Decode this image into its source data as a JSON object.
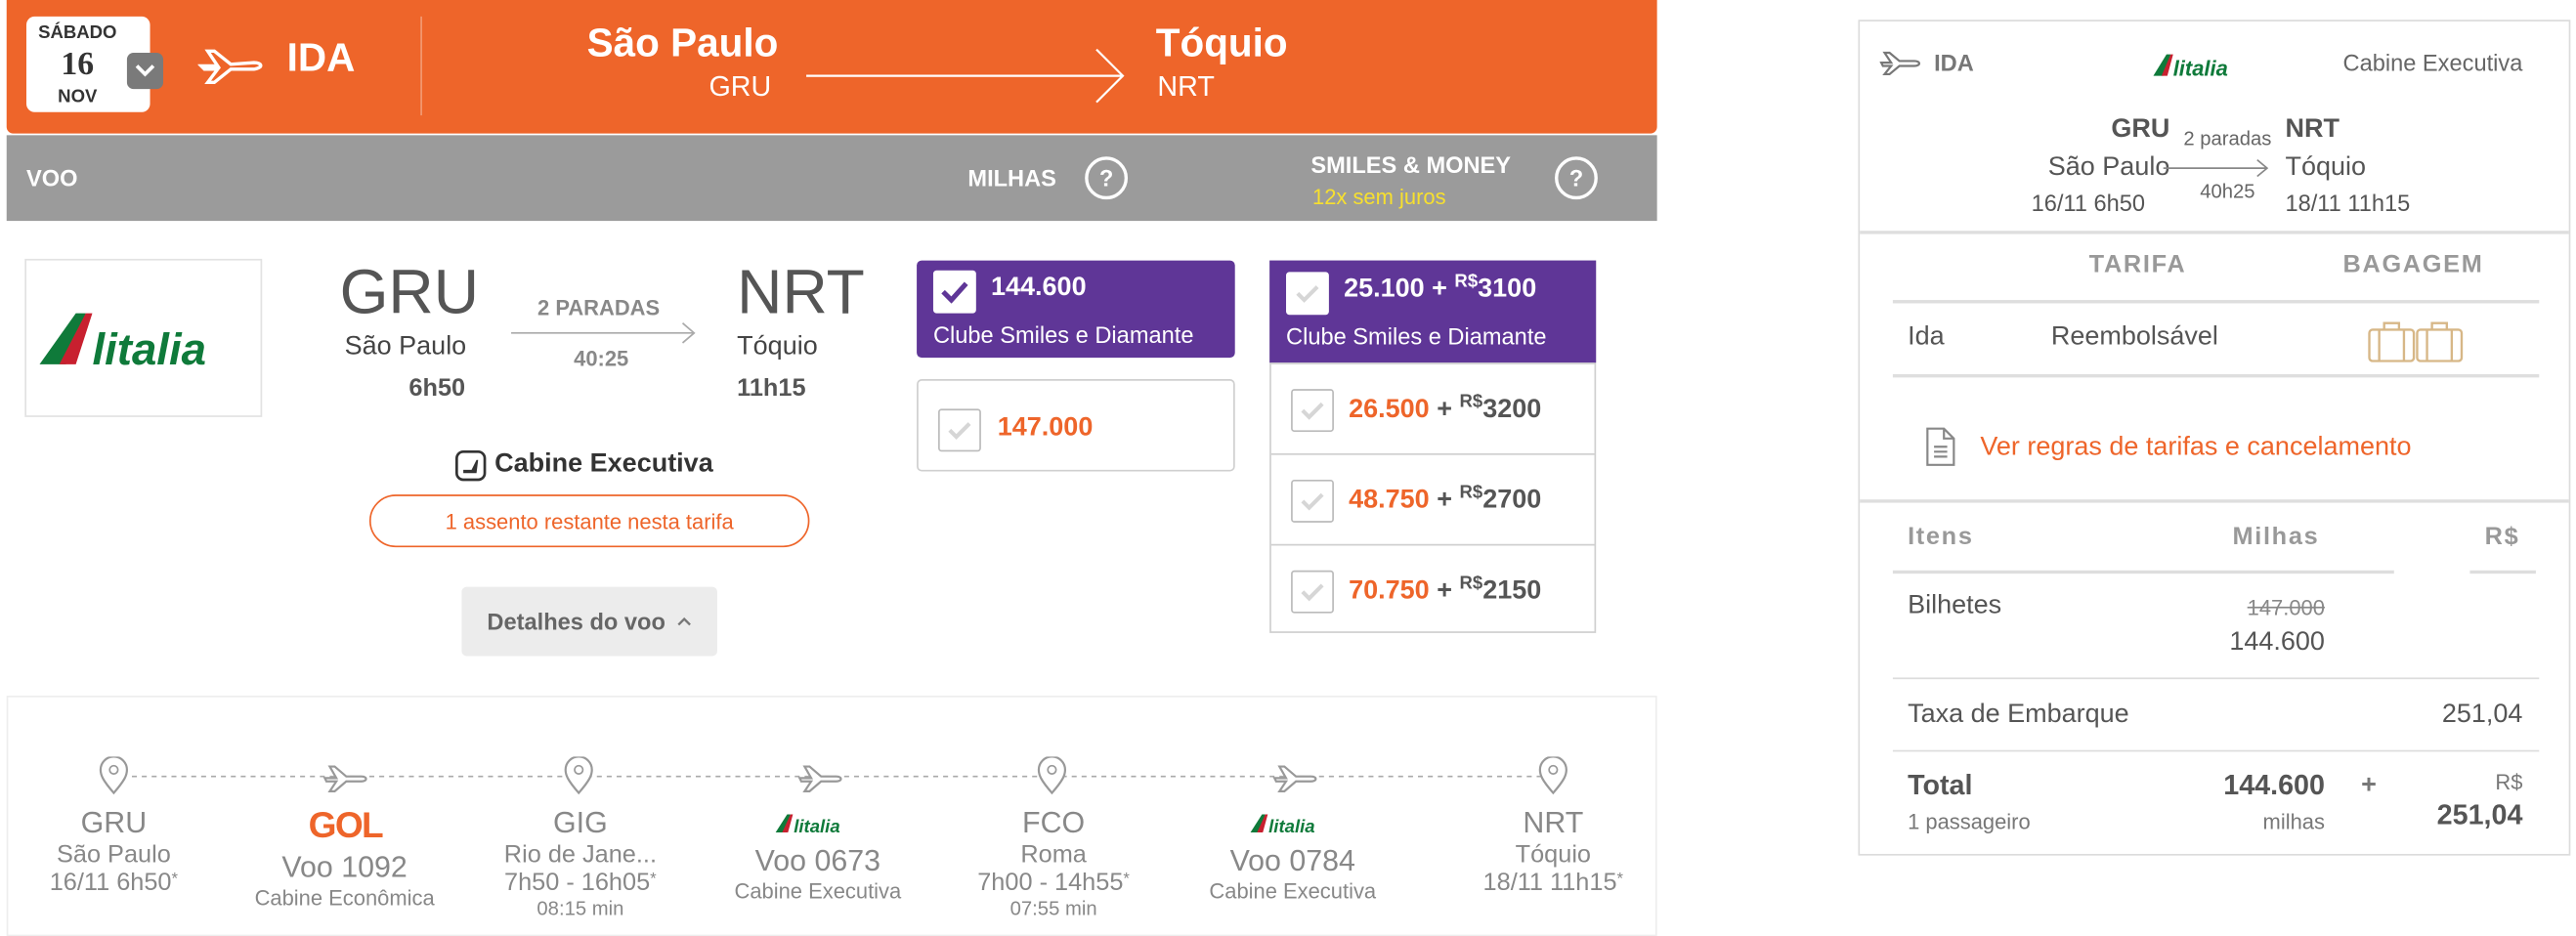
{
  "header": {
    "day_of_week": "SÁBADO",
    "day": "16",
    "month": "NOV",
    "direction": "IDA",
    "from_city": "São Paulo",
    "from_code": "GRU",
    "to_city": "Tóquio",
    "to_code": "NRT"
  },
  "columns": {
    "voo": "VOO",
    "milhas": "MILHAS",
    "smiles_money": "SMILES & MONEY",
    "smiles_money_sub": "12x sem juros",
    "help": "?"
  },
  "flight": {
    "from_code": "GRU",
    "from_city": "São Paulo",
    "from_time": "6h50",
    "stops": "2 PARADAS",
    "duration": "40:25",
    "to_code": "NRT",
    "to_city": "Tóquio",
    "to_time": "11h15",
    "cabin": "Cabine Executiva",
    "seats_left": "1 assento restante nesta tarifa",
    "details_label": "Detalhes do voo"
  },
  "milhas_options": [
    {
      "value": "144.600",
      "sub": "Clube Smiles e Diamante",
      "selected": true
    },
    {
      "value": "147.000",
      "selected": false
    }
  ],
  "smiles_money_options": [
    {
      "miles": "25.100",
      "plus": "+",
      "currency": "R$",
      "money": "3100",
      "sub": "Clube Smiles e Diamante",
      "selected": true
    },
    {
      "miles": "26.500",
      "plus": "+",
      "currency": "R$",
      "money": "3200",
      "selected": false
    },
    {
      "miles": "48.750",
      "plus": "+",
      "currency": "R$",
      "money": "2700",
      "selected": false
    },
    {
      "miles": "70.750",
      "plus": "+",
      "currency": "R$",
      "money": "2150",
      "selected": false
    }
  ],
  "itinerary": {
    "stops": [
      {
        "code": "GRU",
        "city": "São Paulo",
        "time": "16/11 6h50",
        "asterisk": "*"
      },
      {
        "code": "GIG",
        "city": "Rio de Jane...",
        "time": "7h50 - 16h05",
        "asterisk": "*",
        "wait": "08:15 min"
      },
      {
        "code": "FCO",
        "city": "Roma",
        "time": "7h00 - 14h55",
        "asterisk": "*",
        "wait": "07:55 min"
      },
      {
        "code": "NRT",
        "city": "Tóquio",
        "time": "18/11 11h15",
        "asterisk": "*"
      }
    ],
    "legs": [
      {
        "airline": "GOL",
        "flight": "Voo 1092",
        "cabin": "Cabine Econômica"
      },
      {
        "airline": "Alitalia",
        "flight": "Voo 0673",
        "cabin": "Cabine Executiva"
      },
      {
        "airline": "Alitalia",
        "flight": "Voo 0784",
        "cabin": "Cabine Executiva"
      }
    ]
  },
  "summary": {
    "direction": "IDA",
    "airline": "Alitalia",
    "cabin": "Cabine Executiva",
    "from_code": "GRU",
    "from_city": "São Paulo",
    "from_datetime": "16/11 6h50",
    "stops": "2 paradas",
    "duration": "40h25",
    "to_code": "NRT",
    "to_city": "Tóquio",
    "to_datetime": "18/11 11h15",
    "tarifa_header": "TARIFA",
    "bagagem_header": "BAGAGEM",
    "leg_label": "Ida",
    "fare_type": "Reembolsável",
    "rules_link": "Ver regras de tarifas e cancelamento",
    "items_header": "Itens",
    "miles_header": "Milhas",
    "money_header": "R$",
    "tickets_label": "Bilhetes",
    "tickets_old_miles": "147.000",
    "tickets_miles": "144.600",
    "tax_label": "Taxa de Embarque",
    "tax_value": "251,04",
    "total_label": "Total",
    "passengers": "1 passageiro",
    "total_miles": "144.600",
    "miles_unit": "milhas",
    "plus": "+",
    "total_currency": "R$",
    "total_money": "251,04"
  },
  "colors": {
    "accent_orange": "#ee652a",
    "purple": "#5f3697",
    "grey_bar": "#9b9b9b",
    "yellow": "#f7e02e"
  }
}
